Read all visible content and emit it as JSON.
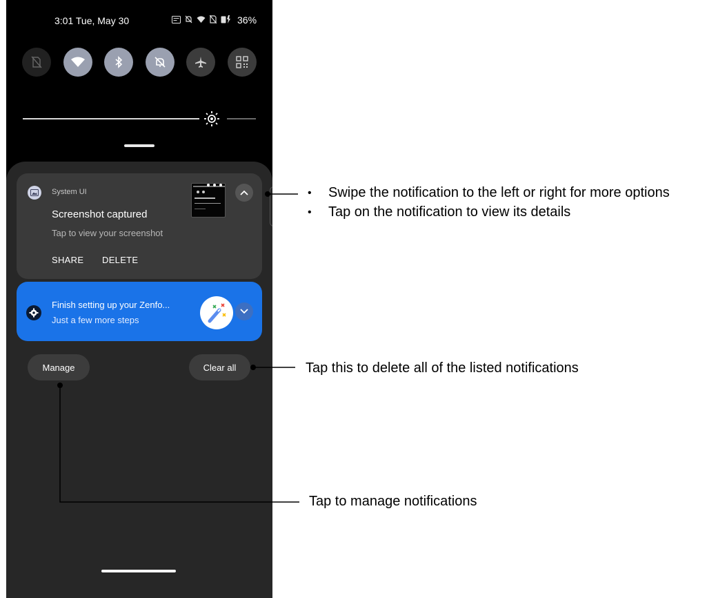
{
  "status_bar": {
    "time": "3:01",
    "date": "Tue, May 30",
    "battery": "36%"
  },
  "quick_settings": [
    {
      "name": "mobile-data-off",
      "state": "off"
    },
    {
      "name": "wifi",
      "state": "on"
    },
    {
      "name": "bluetooth",
      "state": "on"
    },
    {
      "name": "mute",
      "state": "on"
    },
    {
      "name": "airplane-mode",
      "state": "off"
    },
    {
      "name": "qr-scanner",
      "state": "off"
    }
  ],
  "brightness": {
    "level": 0.78
  },
  "notifications": {
    "screenshot": {
      "app_name": "System UI",
      "title": "Screenshot captured",
      "text": "Tap to view your screenshot",
      "action_share": "SHARE",
      "action_delete": "DELETE"
    },
    "setup": {
      "title": "Finish setting up your Zenfo...",
      "text": "Just a few more steps"
    }
  },
  "buttons": {
    "manage": "Manage",
    "clear_all": "Clear all"
  },
  "callouts": {
    "swipe_line1": "Swipe the notification to the left or right for more options",
    "swipe_line2": "Tap on the notification to view its details",
    "clear_all": "Tap this to delete all of the listed notifications",
    "manage": "Tap to manage notifications"
  },
  "colors": {
    "shade": "#272727",
    "card": "#3a3a3a",
    "setup_card": "#1a73e8",
    "active_tile": "#9aa0b0"
  }
}
